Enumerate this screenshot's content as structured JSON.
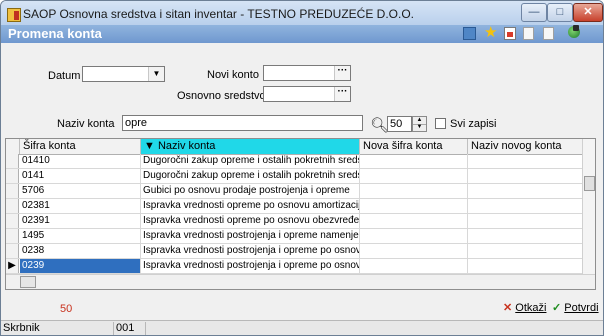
{
  "window": {
    "title": "SAOP Osnovna sredstva i sitan inventar - TESTNO PREDUZEĆE D.O.O.",
    "min": "—",
    "max": "□",
    "close": "✕"
  },
  "header": {
    "title": "Promena konta"
  },
  "filters": {
    "datum_label": "Datum",
    "datum_value": "",
    "novi_konto_label": "Novi konto",
    "novi_konto_value": "",
    "osnovno_sredstvo_label": "Osnovno sredstvo",
    "osnovno_sredstvo_value": "",
    "ellipsis": "···",
    "dropdown_arrow": "▼"
  },
  "search": {
    "label": "Naziv konta",
    "value": "opre",
    "limit": "50",
    "svi_zapisi_label": "Svi zapisi",
    "svi_zapisi_checked": false
  },
  "grid": {
    "columns": [
      "Šifra konta",
      "▼ Naziv konta",
      "Nova šifra konta",
      "Naziv novog konta"
    ],
    "active_column": 1,
    "rows": [
      {
        "sifra": "01410",
        "naziv": "Dugoročni zakup opreme i ostalih pokretnih sredstava"
      },
      {
        "sifra": "0141",
        "naziv": "Dugoročni zakup opreme i ostalih pokretnih sredstava"
      },
      {
        "sifra": "5706",
        "naziv": "Gubici po osnovu prodaje postrojenja i opreme"
      },
      {
        "sifra": "02381",
        "naziv": "Ispravka vrednosti opreme po osnovu amortizacije"
      },
      {
        "sifra": "02391",
        "naziv": "Ispravka vrednosti opreme po osnovu obezvređenja"
      },
      {
        "sifra": "1495",
        "naziv": "Ispravka vrednosti postrojenja i opreme namenjene prodaji"
      },
      {
        "sifra": "0238",
        "naziv": "Ispravka vrednosti postrojenja i opreme po osnovu"
      },
      {
        "sifra": "0239",
        "naziv": "Ispravka vrednosti postrojenja i opreme po osnovu"
      }
    ],
    "selected_row": 7
  },
  "footer": {
    "count": "50",
    "cancel_label": "Otkaži",
    "confirm_label": "Potvrdi"
  },
  "status": {
    "user_label": "Skrbnik",
    "user_value": "001"
  },
  "colors": {
    "header": "#7aa3d6",
    "active_column": "#20d8e8",
    "selection": "#2f6fbf",
    "count_red": "#c8321e"
  }
}
